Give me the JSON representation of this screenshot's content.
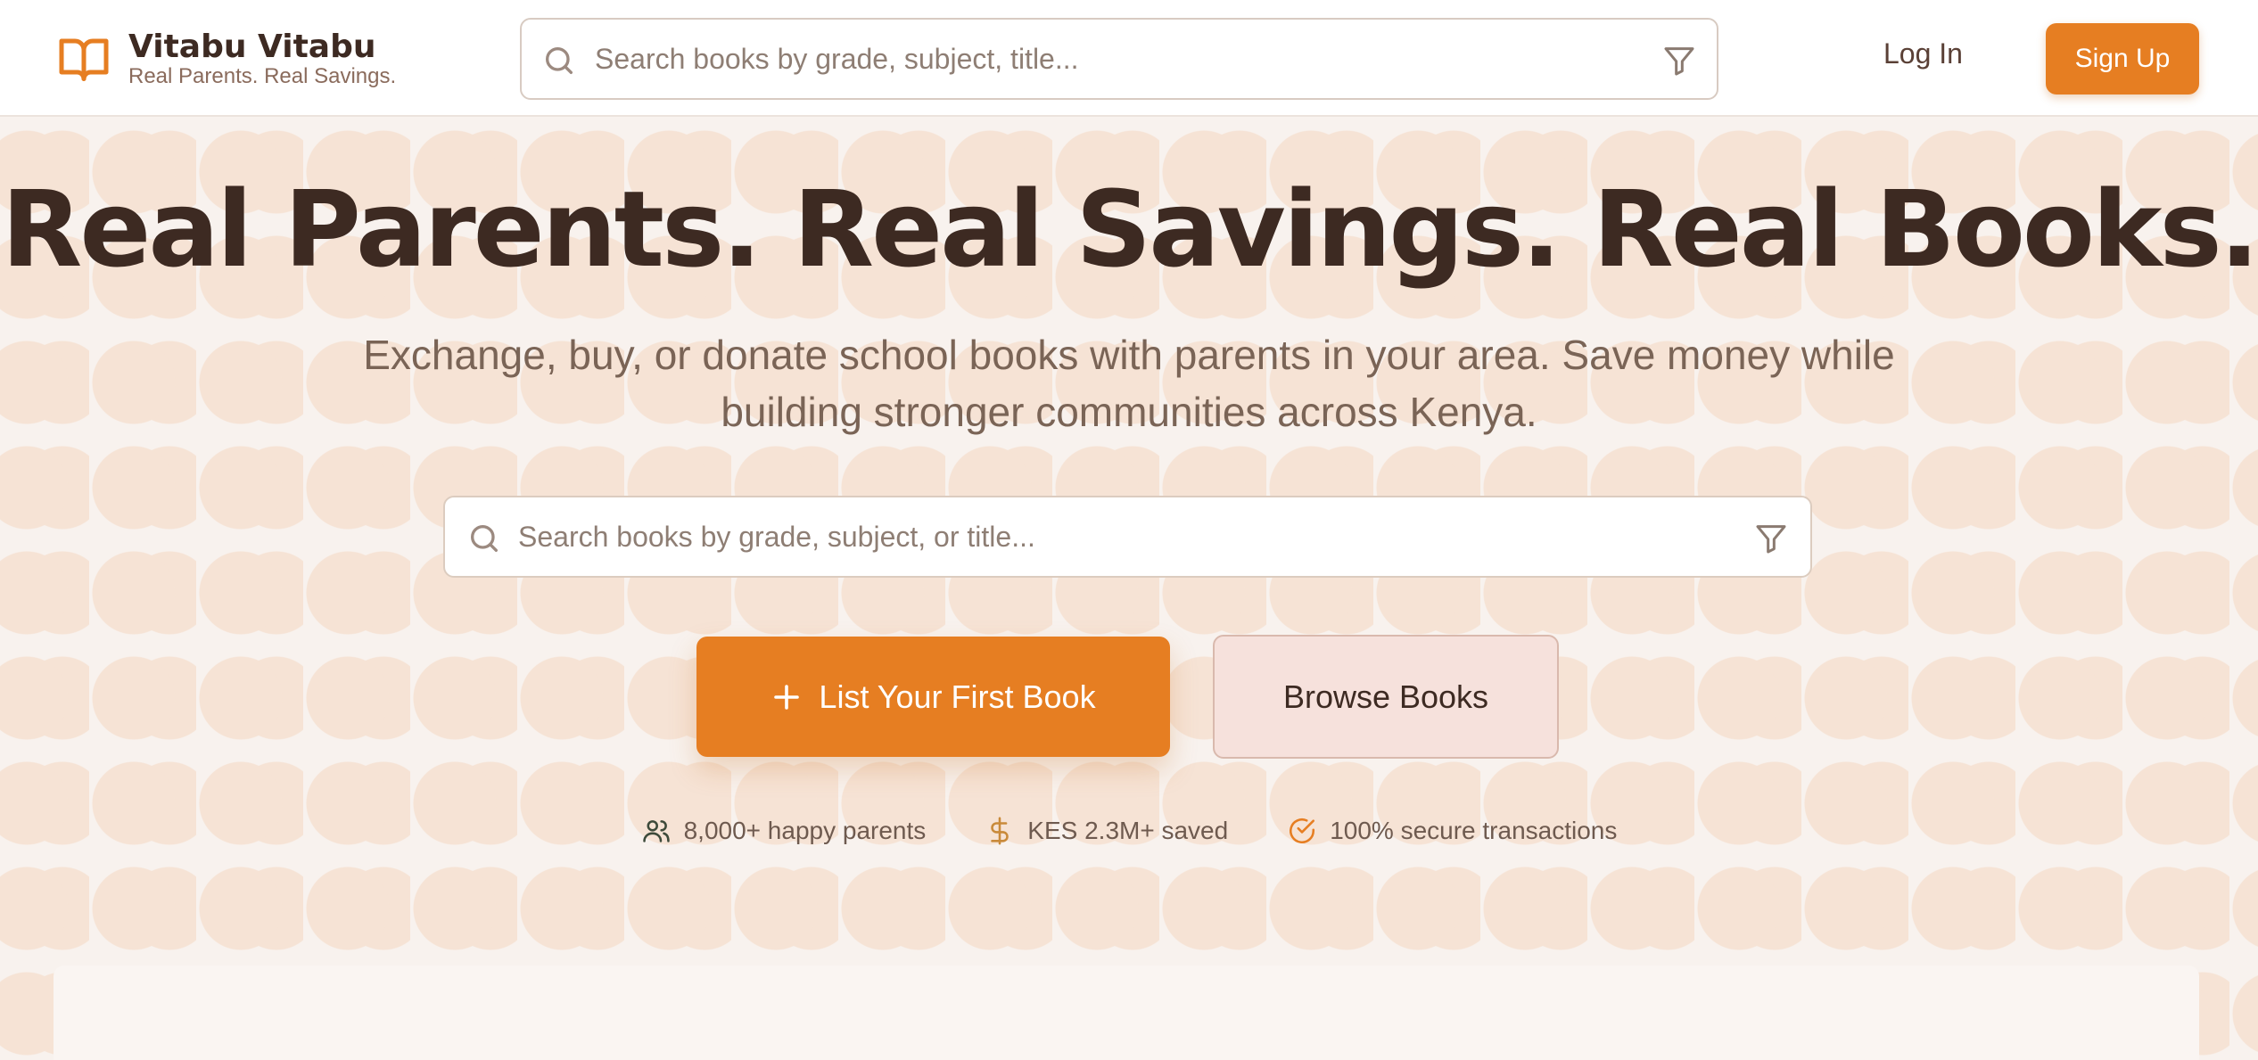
{
  "header": {
    "brand": "Vitabu Vitabu",
    "tagline": "Real Parents. Real Savings.",
    "search_placeholder": "Search books by grade, subject, title...",
    "login_label": "Log In",
    "signup_label": "Sign Up"
  },
  "hero": {
    "title": "Real Parents. Real Savings. Real Books.",
    "subtitle": "Exchange, buy, or donate school books with parents in your area. Save money while building stronger communities across Kenya.",
    "search_placeholder": "Search books by grade, subject, or title...",
    "list_button_label": "List Your First Book",
    "browse_button_label": "Browse Books"
  },
  "stats": [
    {
      "icon": "users-icon",
      "text": "8,000+ happy parents"
    },
    {
      "icon": "dollar-icon",
      "text": "KES 2.3M+ saved"
    },
    {
      "icon": "check-circle-icon",
      "text": "100% secure transactions"
    }
  ],
  "colors": {
    "accent": "#e67e22",
    "text_dark": "#3d2a22",
    "text_muted": "#7a6456",
    "background": "#f8f2ee"
  }
}
